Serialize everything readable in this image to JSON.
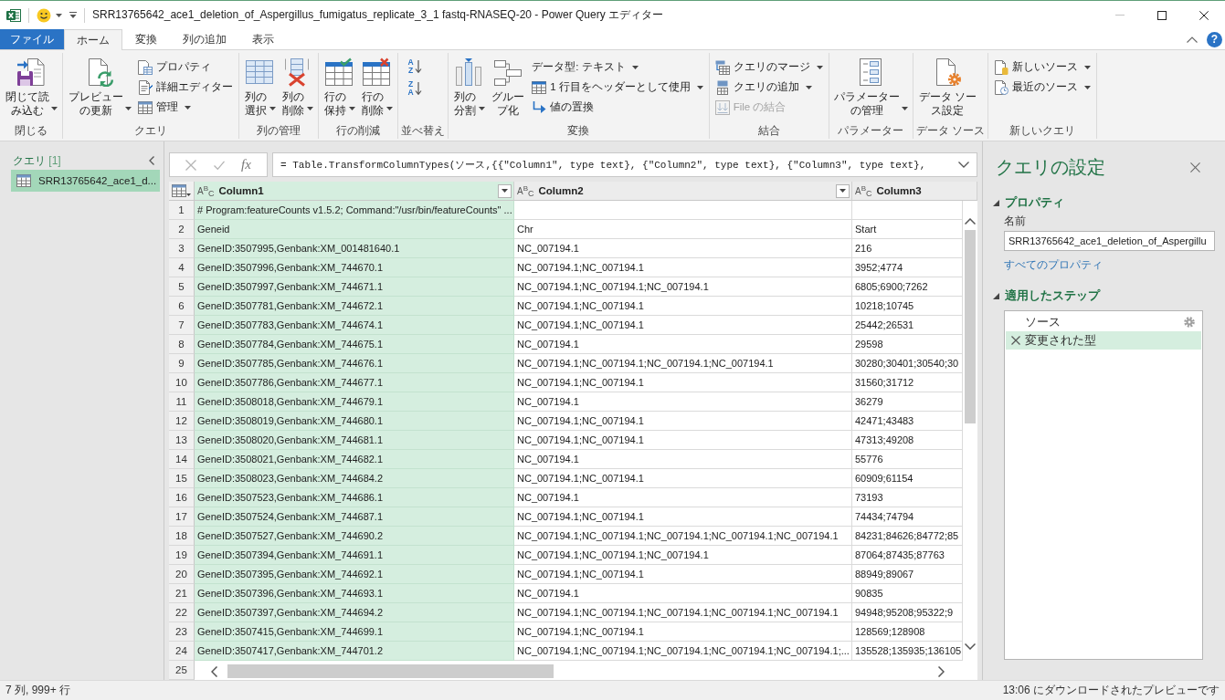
{
  "window": {
    "title": "SRR13765642_ace1_deletion_of_Aspergillus_fumigatus_replicate_3_1 fastq-RNASEQ-20 - Power Query エディター",
    "controls": [
      {
        "kind": "minimize",
        "disabled": true
      },
      {
        "kind": "maximize",
        "disabled": false
      },
      {
        "kind": "close",
        "disabled": false
      }
    ]
  },
  "ribbon": {
    "tabs": [
      {
        "kind": "file",
        "label": "ファイル",
        "selected": false
      },
      {
        "kind": "tab",
        "label": "ホーム",
        "selected": true
      },
      {
        "kind": "tab",
        "label": "変換",
        "selected": false
      },
      {
        "kind": "tab",
        "label": "列の追加",
        "selected": false
      },
      {
        "kind": "tab",
        "label": "表示",
        "selected": false
      }
    ],
    "help": "?",
    "groups": [
      {
        "label": "閉じる",
        "items": [
          {
            "kind": "large",
            "label": "閉じて読み込む",
            "dropdown": true
          }
        ]
      },
      {
        "label": "クエリ",
        "items": [
          {
            "kind": "large",
            "label": "プレビューの更新",
            "dropdown": true
          },
          {
            "kind": "stack",
            "items": [
              {
                "label": "プロパティ",
                "dropdown": false,
                "disabled": false
              },
              {
                "label": "詳細エディター",
                "dropdown": false,
                "disabled": false
              },
              {
                "label": "管理",
                "dropdown": true,
                "disabled": false
              }
            ]
          }
        ]
      },
      {
        "label": "列の管理",
        "items": [
          {
            "kind": "large",
            "label": "列の選択",
            "dropdown": true
          },
          {
            "kind": "large",
            "label": "列の削除",
            "dropdown": true
          }
        ]
      },
      {
        "label": "行の削減",
        "items": [
          {
            "kind": "large",
            "label": "行の保持",
            "dropdown": true
          },
          {
            "kind": "large",
            "label": "行の削除",
            "dropdown": true
          }
        ]
      },
      {
        "label": "並べ替え",
        "items": [
          {
            "kind": "sort",
            "items": [
              {
                "letters": [
                  "A",
                  "Z"
                ]
              },
              {
                "letters": [
                  "Z",
                  "A"
                ]
              }
            ]
          }
        ]
      },
      {
        "label": "変換",
        "items": [
          {
            "kind": "large",
            "label": "列の分割",
            "dropdown": true
          },
          {
            "kind": "large",
            "label": "グループ化",
            "dropdown": false
          },
          {
            "kind": "stack",
            "items": [
              {
                "label": "データ型: テキスト",
                "dropdown": true,
                "disabled": false
              },
              {
                "label": "1 行目をヘッダーとして使用",
                "dropdown": true,
                "disabled": false
              },
              {
                "label": "値の置換",
                "dropdown": false,
                "disabled": false
              }
            ]
          }
        ]
      },
      {
        "label": "結合",
        "items": [
          {
            "kind": "stack",
            "items": [
              {
                "label": "クエリのマージ",
                "dropdown": true,
                "disabled": false
              },
              {
                "label": "クエリの追加",
                "dropdown": true,
                "disabled": false
              },
              {
                "label": "File の結合",
                "dropdown": false,
                "disabled": true
              }
            ]
          }
        ]
      },
      {
        "label": "パラメーター",
        "items": [
          {
            "kind": "large",
            "label": "パラメーターの管理",
            "dropdown": true
          }
        ]
      },
      {
        "label": "データ ソース",
        "items": [
          {
            "kind": "large",
            "label": "データ ソース設定",
            "dropdown": false
          }
        ]
      },
      {
        "label": "新しいクエリ",
        "items": [
          {
            "kind": "stack",
            "items": [
              {
                "label": "新しいソース",
                "dropdown": true,
                "disabled": false
              },
              {
                "label": "最近のソース",
                "dropdown": true,
                "disabled": false
              }
            ]
          }
        ]
      }
    ]
  },
  "queries_pane": {
    "title": "クエリ",
    "count": "[1]",
    "items": [
      {
        "label": "SRR13765642_ace1_d...",
        "selected": true
      }
    ]
  },
  "formula_bar": {
    "function_label": "fx",
    "formula": "= Table.TransformColumnTypes(ソース,{{\"Column1\", type text}, {\"Column2\", type text}, {\"Column3\", type text},"
  },
  "table": {
    "columns": [
      {
        "name": "Column1",
        "type_label": "A$^{B}$$_{C}$",
        "selected": true,
        "filter_button": true
      },
      {
        "name": "Column2",
        "type_label": "A$^{B}$$_{C}$",
        "selected": false,
        "filter_button": true
      },
      {
        "name": "Column3",
        "type_label": "A$^{B}$$_{C}$",
        "selected": false,
        "filter_button": false
      }
    ],
    "rows": [
      {
        "number": "1",
        "cells": [
          "# Program:featureCounts v1.5.2; Command:\"/usr/bin/featureCounts\" ..."
        ]
      },
      {
        "number": "2",
        "cells": [
          "Geneid",
          "Chr",
          "Start"
        ]
      },
      {
        "number": "3",
        "cells": [
          "GeneID:3507995,Genbank:XM_001481640.1",
          "NC_007194.1",
          "216"
        ]
      },
      {
        "number": "4",
        "cells": [
          "GeneID:3507996,Genbank:XM_744670.1",
          "NC_007194.1;NC_007194.1",
          "3952;4774"
        ]
      },
      {
        "number": "5",
        "cells": [
          "GeneID:3507997,Genbank:XM_744671.1",
          "NC_007194.1;NC_007194.1;NC_007194.1",
          "6805;6900;7262"
        ]
      },
      {
        "number": "6",
        "cells": [
          "GeneID:3507781,Genbank:XM_744672.1",
          "NC_007194.1;NC_007194.1",
          "10218;10745"
        ]
      },
      {
        "number": "7",
        "cells": [
          "GeneID:3507783,Genbank:XM_744674.1",
          "NC_007194.1;NC_007194.1",
          "25442;26531"
        ]
      },
      {
        "number": "8",
        "cells": [
          "GeneID:3507784,Genbank:XM_744675.1",
          "NC_007194.1",
          "29598"
        ]
      },
      {
        "number": "9",
        "cells": [
          "GeneID:3507785,Genbank:XM_744676.1",
          "NC_007194.1;NC_007194.1;NC_007194.1;NC_007194.1",
          "30280;30401;30540;30"
        ]
      },
      {
        "number": "10",
        "cells": [
          "GeneID:3507786,Genbank:XM_744677.1",
          "NC_007194.1;NC_007194.1",
          "31560;31712"
        ]
      },
      {
        "number": "11",
        "cells": [
          "GeneID:3508018,Genbank:XM_744679.1",
          "NC_007194.1",
          "36279"
        ]
      },
      {
        "number": "12",
        "cells": [
          "GeneID:3508019,Genbank:XM_744680.1",
          "NC_007194.1;NC_007194.1",
          "42471;43483"
        ]
      },
      {
        "number": "13",
        "cells": [
          "GeneID:3508020,Genbank:XM_744681.1",
          "NC_007194.1;NC_007194.1",
          "47313;49208"
        ]
      },
      {
        "number": "14",
        "cells": [
          "GeneID:3508021,Genbank:XM_744682.1",
          "NC_007194.1",
          "55776"
        ]
      },
      {
        "number": "15",
        "cells": [
          "GeneID:3508023,Genbank:XM_744684.2",
          "NC_007194.1;NC_007194.1",
          "60909;61154"
        ]
      },
      {
        "number": "16",
        "cells": [
          "GeneID:3507523,Genbank:XM_744686.1",
          "NC_007194.1",
          "73193"
        ]
      },
      {
        "number": "17",
        "cells": [
          "GeneID:3507524,Genbank:XM_744687.1",
          "NC_007194.1;NC_007194.1",
          "74434;74794"
        ]
      },
      {
        "number": "18",
        "cells": [
          "GeneID:3507527,Genbank:XM_744690.2",
          "NC_007194.1;NC_007194.1;NC_007194.1;NC_007194.1;NC_007194.1",
          "84231;84626;84772;85"
        ]
      },
      {
        "number": "19",
        "cells": [
          "GeneID:3507394,Genbank:XM_744691.1",
          "NC_007194.1;NC_007194.1;NC_007194.1",
          "87064;87435;87763"
        ]
      },
      {
        "number": "20",
        "cells": [
          "GeneID:3507395,Genbank:XM_744692.1",
          "NC_007194.1;NC_007194.1",
          "88949;89067"
        ]
      },
      {
        "number": "21",
        "cells": [
          "GeneID:3507396,Genbank:XM_744693.1",
          "NC_007194.1",
          "90835"
        ]
      },
      {
        "number": "22",
        "cells": [
          "GeneID:3507397,Genbank:XM_744694.2",
          "NC_007194.1;NC_007194.1;NC_007194.1;NC_007194.1;NC_007194.1",
          "94948;95208;95322;9"
        ]
      },
      {
        "number": "23",
        "cells": [
          "GeneID:3507415,Genbank:XM_744699.1",
          "NC_007194.1;NC_007194.1",
          "128569;128908"
        ]
      },
      {
        "number": "24",
        "cells": [
          "GeneID:3507417,Genbank:XM_744701.2",
          "NC_007194.1;NC_007194.1;NC_007194.1;NC_007194.1;NC_007194.1;...",
          "135528;135935;136105"
        ]
      }
    ],
    "partial_row": {
      "number": "25"
    }
  },
  "settings_pane": {
    "title": "クエリの設定",
    "sections": [
      {
        "kind": "properties",
        "title": "プロパティ",
        "expanded": true,
        "name_label": "名前",
        "name_value": "SRR13765642_ace1_deletion_of_Aspergillu",
        "link": "すべてのプロパティ"
      },
      {
        "kind": "steps",
        "title": "適用したステップ",
        "expanded": true,
        "steps": [
          {
            "label": "ソース",
            "selected": false,
            "settings": true
          },
          {
            "label": "変更された型",
            "selected": true,
            "settings": false
          }
        ]
      }
    ]
  },
  "status_bar": {
    "left": "7 列, 999+ 行",
    "right": "13:06 にダウンロードされたプレビューです"
  }
}
